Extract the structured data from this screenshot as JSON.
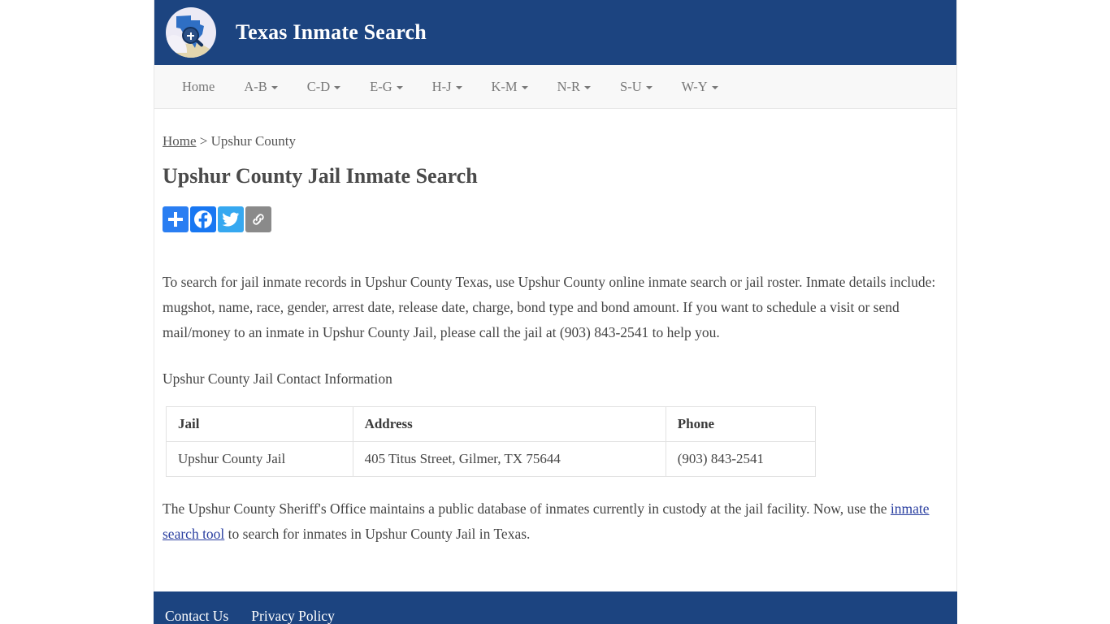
{
  "site": {
    "title": "Texas Inmate Search",
    "logo_icon": "texas-magnifier-logo"
  },
  "nav": {
    "items": [
      {
        "label": "Home",
        "has_caret": false
      },
      {
        "label": "A-B",
        "has_caret": true
      },
      {
        "label": "C-D",
        "has_caret": true
      },
      {
        "label": "E-G",
        "has_caret": true
      },
      {
        "label": "H-J",
        "has_caret": true
      },
      {
        "label": "K-M",
        "has_caret": true
      },
      {
        "label": "N-R",
        "has_caret": true
      },
      {
        "label": "S-U",
        "has_caret": true
      },
      {
        "label": "W-Y",
        "has_caret": true
      }
    ]
  },
  "breadcrumb": {
    "home_label": "Home",
    "separator": " > ",
    "current": "Upshur County"
  },
  "page": {
    "title": "Upshur County Jail Inmate Search"
  },
  "share": {
    "buttons": [
      {
        "name": "addthis-share-button",
        "icon": "plus-icon",
        "color": "#2a7ef2"
      },
      {
        "name": "facebook-share-button",
        "icon": "facebook-icon",
        "color": "#1877f2"
      },
      {
        "name": "twitter-share-button",
        "icon": "twitter-icon",
        "color": "#36a8f0"
      },
      {
        "name": "copy-link-button",
        "icon": "chain-link-icon",
        "color": "#8a8a8a"
      }
    ]
  },
  "content": {
    "intro_paragraph": "To search for jail inmate records in Upshur County Texas, use Upshur County online inmate search or jail roster. Inmate details include: mugshot, name, race, gender, arrest date, release date, charge, bond type and bond amount. If you want to schedule a visit or send mail/money to an inmate in Upshur County Jail, please call the jail at (903) 843-2541 to help you.",
    "contact_heading": "Upshur County Jail Contact Information",
    "closing_prefix": "The Upshur County Sheriff's Office maintains a public database of inmates currently in custody at the jail facility. Now, use the ",
    "closing_link": "inmate search tool",
    "closing_suffix": " to search for inmates in Upshur County Jail in Texas."
  },
  "table": {
    "headers": [
      "Jail",
      "Address",
      "Phone"
    ],
    "rows": [
      [
        "Upshur County Jail",
        "405 Titus Street, Gilmer, TX 75644",
        "(903) 843-2541"
      ]
    ]
  },
  "footer": {
    "links": [
      "Contact Us",
      "Privacy Policy"
    ]
  },
  "colors": {
    "header_blue": "#1c4480",
    "nav_bg": "#f8f8f8",
    "link_blue": "#2a3fa0",
    "text_gray": "#444444"
  }
}
